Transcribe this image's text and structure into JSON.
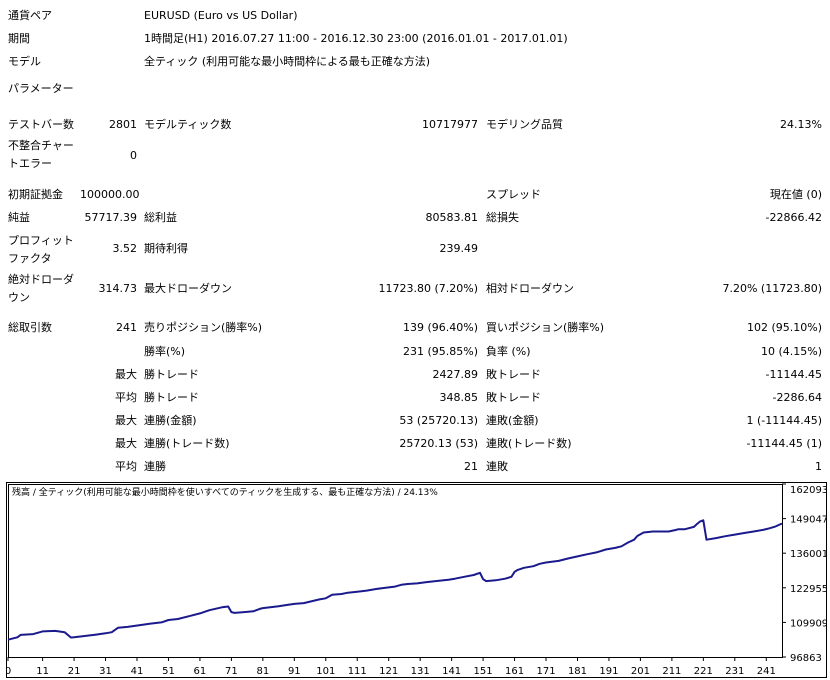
{
  "header": {
    "symbol_label": "通貨ペア",
    "symbol_value": "EURUSD (Euro vs US Dollar)",
    "period_label": "期間",
    "period_value": "1時間足(H1) 2016.07.27 11:00 - 2016.12.30 23:00 (2016.01.01 - 2017.01.01)",
    "model_label": "モデル",
    "model_value": "全ティック (利用可能な最小時間枠による最も正確な方法)",
    "params_label": "パラメーター"
  },
  "stats": {
    "bars_label": "テストバー数",
    "bars_value": "2801",
    "ticks_label": "モデルティック数",
    "ticks_value": "10717977",
    "quality_label": "モデリング品質",
    "quality_value": "24.13%",
    "mismatch_label": "不整合チャートエラー",
    "mismatch_value": "0",
    "deposit_label": "初期証拠金",
    "deposit_value": "100000.00",
    "spread_label": "スプレッド",
    "spread_value": "現在値 (0)",
    "netprofit_label": "純益",
    "netprofit_value": "57717.39",
    "grossprofit_label": "総利益",
    "grossprofit_value": "80583.81",
    "grossloss_label": "総損失",
    "grossloss_value": "-22866.42",
    "pf_label": "プロフィットファクタ",
    "pf_value": "3.52",
    "expected_label": "期待利得",
    "expected_value": "239.49",
    "absdd_label": "絶対ドローダウン",
    "absdd_value": "314.73",
    "maxdd_label": "最大ドローダウン",
    "maxdd_value": "11723.80 (7.20%)",
    "reldd_label": "相対ドローダウン",
    "reldd_value": "7.20% (11723.80)",
    "trades_label": "総取引数",
    "trades_value": "241",
    "short_label": "売りポジション(勝率%)",
    "short_value": "139 (96.40%)",
    "long_label": "買いポジション(勝率%)",
    "long_value": "102 (95.10%)",
    "winpct_label": "勝率(%)",
    "winpct_value": "231 (95.85%)",
    "losspct_label": "負率 (%)",
    "losspct_value": "10 (4.15%)",
    "max_prefix": "最大",
    "avg_prefix": "平均",
    "largest_win_label": "勝トレード",
    "largest_win_value": "2427.89",
    "largest_loss_label": "敗トレード",
    "largest_loss_value": "-11144.45",
    "avg_win_label": "勝トレード",
    "avg_win_value": "348.85",
    "avg_loss_label": "敗トレード",
    "avg_loss_value": "-2286.64",
    "consec_win_money_label": "連勝(金額)",
    "consec_win_money_value": "53 (25720.13)",
    "consec_loss_money_label": "連敗(金額)",
    "consec_loss_money_value": "1 (-11144.45)",
    "consec_win_trades_label": "連勝(トレード数)",
    "consec_win_trades_value": "25720.13 (53)",
    "consec_loss_trades_label": "連敗(トレード数)",
    "consec_loss_trades_value": "-11144.45 (1)",
    "avg_consec_win_label": "連勝",
    "avg_consec_win_value": "21",
    "avg_consec_loss_label": "連敗",
    "avg_consec_loss_value": "1"
  },
  "chart_data": {
    "type": "line",
    "legend": "残高 / 全ティック(利用可能な最小時間枠を使いすべてのティックを生成する、最も正確な方法) / 24.13%",
    "x_ticks": [
      "0",
      "11",
      "21",
      "31",
      "41",
      "51",
      "61",
      "71",
      "81",
      "91",
      "101",
      "111",
      "121",
      "131",
      "141",
      "151",
      "161",
      "171",
      "181",
      "191",
      "201",
      "211",
      "221",
      "231",
      "241"
    ],
    "y_ticks": [
      "162093",
      "149047",
      "136001",
      "122955",
      "109909",
      "96863"
    ],
    "ylim": [
      96863,
      162093
    ],
    "xlim": [
      0,
      246
    ],
    "color": "#1a1a8c",
    "series": [
      {
        "x": [
          0,
          3,
          4,
          8,
          11,
          15,
          18,
          20,
          21,
          25,
          28,
          31,
          33,
          35,
          38,
          42,
          45,
          49,
          51,
          54,
          58,
          61,
          64,
          68,
          70,
          71,
          72,
          75,
          78,
          80,
          81,
          84,
          86,
          88,
          91,
          94,
          97,
          99,
          101,
          103,
          106,
          108,
          111,
          114,
          117,
          120,
          123,
          125,
          127,
          130,
          133,
          137,
          140,
          142,
          145,
          148,
          150,
          151,
          152,
          155,
          158,
          160,
          161,
          162,
          164,
          167,
          169,
          171,
          175,
          178,
          181,
          184,
          187,
          190,
          193,
          195,
          197,
          199,
          200,
          202,
          205,
          208,
          210,
          212,
          213,
          215,
          218,
          219,
          220,
          221,
          222,
          225,
          228,
          231,
          234,
          237,
          240,
          242,
          244,
          246
        ],
        "y": [
          103400,
          104300,
          105200,
          105500,
          106500,
          106700,
          106200,
          104200,
          104300,
          104900,
          105300,
          105800,
          106200,
          107900,
          108200,
          108900,
          109400,
          110000,
          110800,
          111200,
          112400,
          113300,
          114500,
          115600,
          115900,
          113800,
          113500,
          113800,
          114100,
          115000,
          115300,
          115700,
          116000,
          116400,
          116900,
          117200,
          118000,
          118600,
          119000,
          120300,
          120600,
          121100,
          121500,
          121900,
          122500,
          123000,
          123400,
          124100,
          124400,
          124600,
          125100,
          125600,
          126000,
          126400,
          127100,
          127800,
          128600,
          126200,
          125500,
          125800,
          126400,
          127100,
          129000,
          129700,
          130500,
          131100,
          132000,
          132500,
          133100,
          134000,
          134800,
          135600,
          136300,
          137400,
          138000,
          138600,
          140000,
          141100,
          142500,
          143800,
          144200,
          144200,
          144200,
          144700,
          145000,
          145000,
          145900,
          147000,
          148000,
          148400,
          141100,
          141700,
          142400,
          143000,
          143600,
          144200,
          144800,
          145400,
          146100,
          147200
        ]
      }
    ]
  }
}
